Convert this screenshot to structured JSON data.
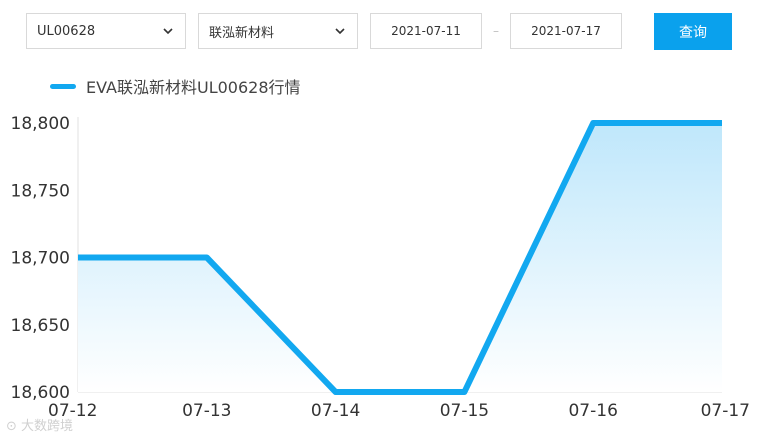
{
  "controls": {
    "product_select": "UL00628",
    "company_select": "联泓新材料",
    "start_date": "2021-07-11",
    "date_separator": "–",
    "end_date": "2021-07-17",
    "query_label": "查询"
  },
  "watermark": "大数跨境",
  "colors": {
    "accent": "#0aa1ed",
    "line": "#12a8f0",
    "fill_top": "#bfe7fb",
    "fill_bottom": "#ffffff"
  },
  "chart_data": {
    "type": "area",
    "x": [
      "07-12",
      "07-13",
      "07-14",
      "07-15",
      "07-16",
      "07-17"
    ],
    "series": [
      {
        "name": "EVA联泓新材料UL00628行情",
        "values": [
          18700,
          18700,
          18600,
          18600,
          18800,
          18800
        ]
      }
    ],
    "ylim": [
      18600,
      18800
    ],
    "yticks": [
      18600,
      18650,
      18700,
      18750,
      18800
    ],
    "ytick_labels": [
      "18,600",
      "18,650",
      "18,700",
      "18,750",
      "18,800"
    ],
    "legend_position": "top-left",
    "grid": false
  }
}
